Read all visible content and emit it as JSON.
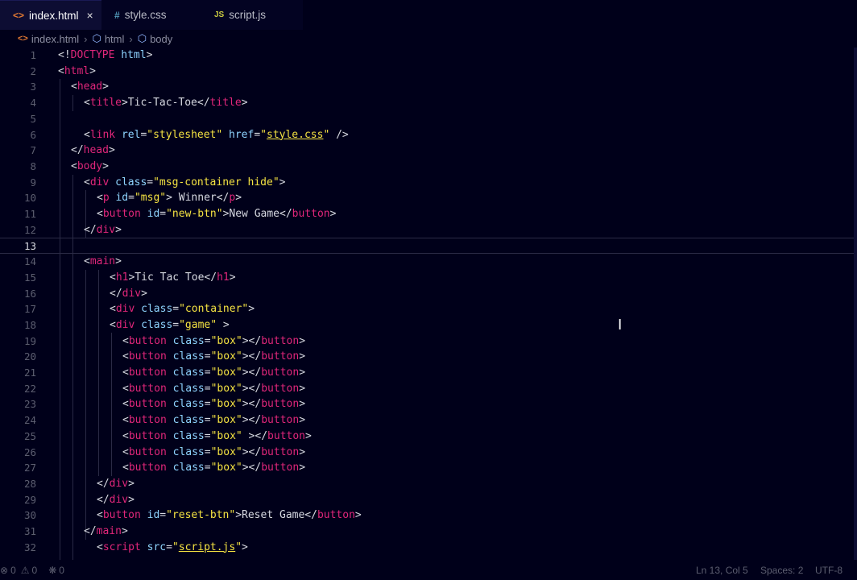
{
  "tabs": [
    {
      "icon": "<>",
      "label": "index.html",
      "close": "×",
      "active": true
    },
    {
      "icon": "#",
      "label": "style.css",
      "active": false
    },
    {
      "icon": "JS",
      "label": "script.js",
      "active": false
    }
  ],
  "breadcrumb": {
    "file": "index.html",
    "items": [
      "html",
      "body"
    ]
  },
  "editor": {
    "current_line": 13,
    "lines": [
      {
        "n": "1"
      },
      {
        "n": "2"
      },
      {
        "n": "3"
      },
      {
        "n": "4"
      },
      {
        "n": "5"
      },
      {
        "n": "6"
      },
      {
        "n": "7"
      },
      {
        "n": "8"
      },
      {
        "n": "9"
      },
      {
        "n": "10"
      },
      {
        "n": "11"
      },
      {
        "n": "12"
      },
      {
        "n": "13"
      },
      {
        "n": "14"
      },
      {
        "n": "15"
      },
      {
        "n": "16"
      },
      {
        "n": "17"
      },
      {
        "n": "18"
      },
      {
        "n": "19"
      },
      {
        "n": "20"
      },
      {
        "n": "21"
      },
      {
        "n": "22"
      },
      {
        "n": "23"
      },
      {
        "n": "24"
      },
      {
        "n": "25"
      },
      {
        "n": "26"
      },
      {
        "n": "27"
      },
      {
        "n": "28"
      },
      {
        "n": "29"
      },
      {
        "n": "30"
      },
      {
        "n": "31"
      },
      {
        "n": "32"
      }
    ],
    "code": {
      "l1": {
        "a": "<!",
        "b": "DOCTYPE",
        "c": " ",
        "d": "html",
        "e": ">"
      },
      "l2": {
        "a": "<",
        "b": "html",
        "c": ">"
      },
      "l3": {
        "a": "<",
        "b": "head",
        "c": ">"
      },
      "l4": {
        "a": "<",
        "b": "title",
        "c": ">Tic-Tac-Toe</",
        "d": "title",
        "e": ">"
      },
      "l6": {
        "a": "<",
        "b": "link",
        "c": " ",
        "d": "rel",
        "e": "=",
        "f": "\"stylesheet\"",
        "g": " ",
        "h": "href",
        "i": "=",
        "j": "\"",
        "k": "style.css",
        "l": "\"",
        "m": " />"
      },
      "l7": {
        "a": "</",
        "b": "head",
        "c": ">"
      },
      "l8": {
        "a": "<",
        "b": "body",
        "c": ">"
      },
      "l9": {
        "a": "<",
        "b": "div",
        "c": " ",
        "d": "class",
        "e": "=",
        "f": "\"msg-container hide\"",
        "g": ">"
      },
      "l10": {
        "a": "<",
        "b": "p",
        "c": " ",
        "d": "id",
        "e": "=",
        "f": "\"msg\"",
        "g": "> Winner</",
        "h": "p",
        "i": ">"
      },
      "l11": {
        "a": "<",
        "b": "button",
        "c": " ",
        "d": "id",
        "e": "=",
        "f": "\"new-btn\"",
        "g": ">New Game</",
        "h": "button",
        "i": ">"
      },
      "l12": {
        "a": "</",
        "b": "div",
        "c": ">"
      },
      "l14": {
        "a": "<",
        "b": "main",
        "c": ">"
      },
      "l15": {
        "a": "<",
        "b": "h1",
        "c": ">Tic Tac Toe</",
        "d": "h1",
        "e": ">"
      },
      "l16": {
        "a": "</",
        "b": "div",
        "c": ">"
      },
      "l17": {
        "a": "<",
        "b": "div",
        "c": " ",
        "d": "class",
        "e": "=",
        "f": "\"container\"",
        "g": ">"
      },
      "l18": {
        "a": "<",
        "b": "div",
        "c": " ",
        "d": "class",
        "e": "=",
        "f": "\"game\"",
        "g": " >"
      },
      "box": {
        "a": "<",
        "b": "button",
        "c": " ",
        "d": "class",
        "e": "=",
        "f": "\"box\"",
        "g": "></",
        "h": "button",
        "i": ">"
      },
      "box25": {
        "a": "<",
        "b": "button",
        "c": " ",
        "d": "class",
        "e": "=",
        "f": "\"box\"",
        "g": " ></",
        "h": "button",
        "i": ">"
      },
      "l28": {
        "a": "</",
        "b": "div",
        "c": ">"
      },
      "l29": {
        "a": "</",
        "b": "div",
        "c": ">"
      },
      "l30": {
        "a": "<",
        "b": "button",
        "c": " ",
        "d": "id",
        "e": "=",
        "f": "\"reset-btn\"",
        "g": ">Reset Game</",
        "h": "button",
        "i": ">"
      },
      "l31": {
        "a": "</",
        "b": "main",
        "c": ">"
      },
      "l32": {
        "a": "<",
        "b": "script",
        "c": " ",
        "d": "src",
        "e": "=",
        "f": "\"",
        "g": "script.js",
        "h": "\"",
        "i": ">"
      }
    }
  },
  "statusbar": {
    "errors": "0",
    "warnings": "0",
    "ports": "0",
    "position": "Ln 13, Col 5",
    "spaces": "Spaces: 2",
    "encoding": "UTF-8"
  },
  "colors": {
    "background": "#00001a",
    "tag": "#e0267a",
    "attribute": "#8fd4ff",
    "string": "#f4e242",
    "text": "#d6d8e0"
  }
}
